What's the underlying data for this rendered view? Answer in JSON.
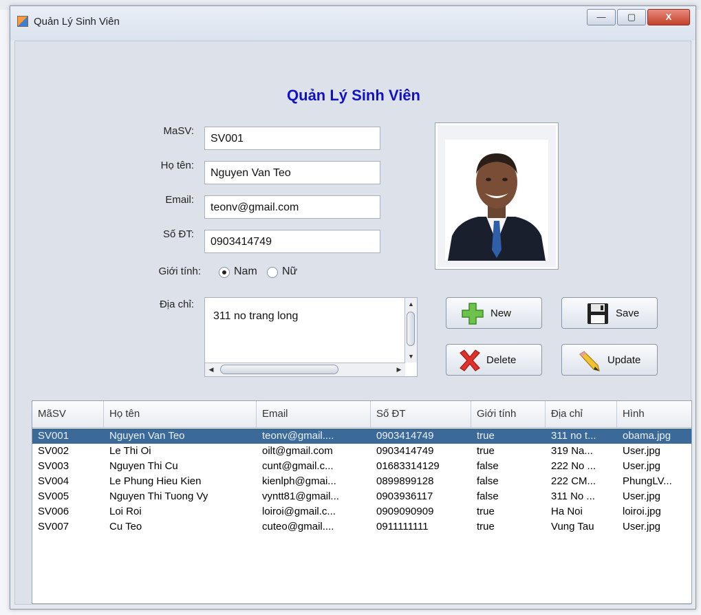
{
  "window": {
    "title": "Quản Lý Sinh Viên",
    "minimize_glyph": "—",
    "maximize_glyph": "▢",
    "close_glyph": "X"
  },
  "heading": "Quản Lý Sinh Viên",
  "form": {
    "masv_label": "MaSV:",
    "masv_value": "SV001",
    "hoten_label": "Họ tên:",
    "hoten_value": "Nguyen Van Teo",
    "email_label": "Email:",
    "email_value": "teonv@gmail.com",
    "sdt_label": "Số ĐT:",
    "sdt_value": "0903414749",
    "gioitinh_label": "Giới tính:",
    "gender_male": "Nam",
    "gender_female": "Nữ",
    "gender_selected": "Nam",
    "diachi_label": "Địa chỉ:",
    "diachi_value": "311 no trang long"
  },
  "buttons": {
    "new": "New",
    "save": "Save",
    "delete": "Delete",
    "update": "Update"
  },
  "icons": {
    "new": "plus-icon",
    "save": "floppy-disk-icon",
    "delete": "red-x-icon",
    "update": "pencil-icon"
  },
  "table": {
    "headers": [
      "MãSV",
      "Họ tên",
      "Email",
      "Số ĐT",
      "Giới tính",
      "Địa chỉ",
      "Hình"
    ],
    "rows": [
      [
        "SV001",
        "Nguyen Van Teo",
        "teonv@gmail....",
        "0903414749",
        "true",
        "311 no t...",
        "obama.jpg"
      ],
      [
        "SV002",
        "Le Thi Oi",
        "oilt@gmail.com",
        "0903414749",
        "true",
        "319 Na...",
        "User.jpg"
      ],
      [
        "SV003",
        "Nguyen Thi Cu",
        "cunt@gmail.c...",
        "01683314129",
        "false",
        "222 No ...",
        "User.jpg"
      ],
      [
        "SV004",
        "Le Phung Hieu Kien",
        "kienlph@gmai...",
        "0899899128",
        "false",
        "222 CM...",
        "PhungLV..."
      ],
      [
        "SV005",
        "Nguyen Thi Tuong Vy",
        "vyntt81@gmail...",
        "0903936117",
        "false",
        "311 No ...",
        "User.jpg"
      ],
      [
        "SV006",
        "Loi Roi",
        "loiroi@gmail.c...",
        "0909090909",
        "true",
        "Ha Noi",
        "loiroi.jpg"
      ],
      [
        "SV007",
        "Cu Teo",
        "cuteo@gmail....",
        "0911111111",
        "true",
        "Vung Tau",
        "User.jpg"
      ]
    ],
    "selected_row": 0
  }
}
